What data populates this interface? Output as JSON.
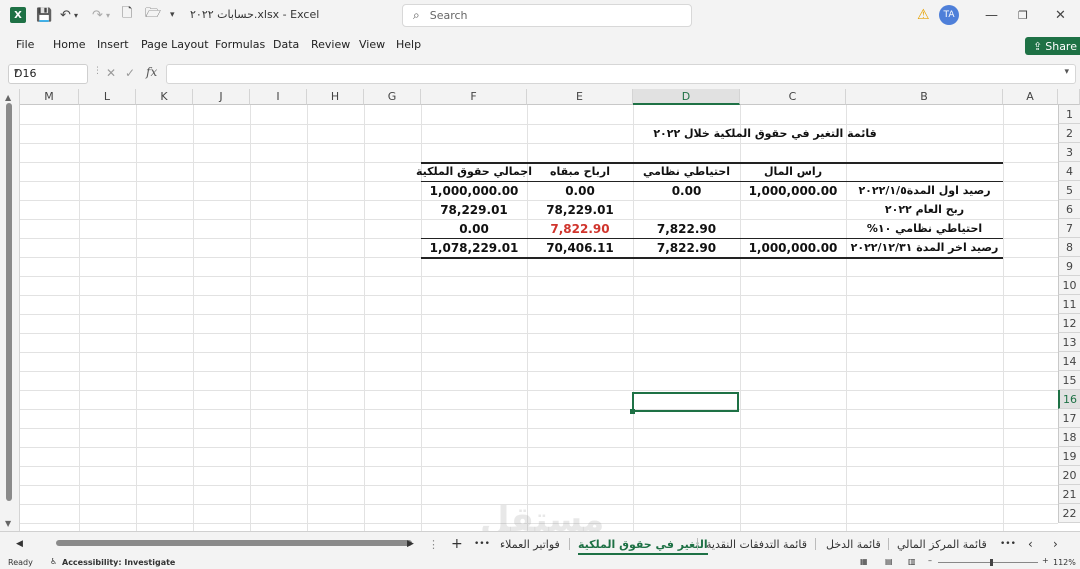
{
  "app": {
    "logo": "X",
    "file_title": "حسابات ٢٠٢٢.xlsx  -  Excel",
    "search_placeholder": "Search",
    "user_initials": "TA",
    "share_label": "Share"
  },
  "menu": [
    "File",
    "Home",
    "Insert",
    "Page Layout",
    "Formulas",
    "Data",
    "Review",
    "View",
    "Help"
  ],
  "formula_bar": {
    "cell_ref": "D16",
    "fx": "fx",
    "content": ""
  },
  "columns": [
    "M",
    "L",
    "K",
    "J",
    "I",
    "H",
    "G",
    "F",
    "E",
    "D",
    "C",
    "B",
    "A"
  ],
  "rows": [
    "1",
    "2",
    "3",
    "4",
    "5",
    "6",
    "7",
    "8",
    "9",
    "10",
    "11",
    "12",
    "13",
    "14",
    "15",
    "16",
    "17",
    "18",
    "19",
    "20",
    "21",
    "22"
  ],
  "selected": {
    "column": "D",
    "row": "16"
  },
  "sheet": {
    "title": "قائمة التغير في حقوق الملكية خلال ٢٠٢٢",
    "headers": {
      "capital": "راس المال",
      "legal_reserve": "احتياطي نظامي",
      "retained_earnings": "ارباح مبقاه",
      "total_equity": "اجمالي حقوق الملكية"
    },
    "rows": [
      {
        "label": "رصيد اول المدة٢٠٢٢/١/٥",
        "capital": "1,000,000.00",
        "legal_reserve": "0.00",
        "retained_earnings": "0.00",
        "total": "1,000,000.00"
      },
      {
        "label": "ربح العام ٢٠٢٢",
        "capital": "",
        "legal_reserve": "",
        "retained_earnings": "78,229.01",
        "total": "78,229.01"
      },
      {
        "label": "احتياطي نظامي ١٠%",
        "capital": "",
        "legal_reserve": "7,822.90",
        "retained_earnings": "7,822.90",
        "total": "0.00"
      },
      {
        "label": "رصيد اخر المدة ٢٠٢٢/١٢/٣١",
        "capital": "1,000,000.00",
        "legal_reserve": "7,822.90",
        "retained_earnings": "70,406.11",
        "total": "1,078,229.01"
      }
    ],
    "highlight_color": "#d0342c"
  },
  "tabs": {
    "items": [
      "قائمة المركز المالي",
      "قائمة الدخل",
      "قائمة التدفقات النقدية",
      "التغير في حقوق الملكية",
      "فواتير العملاء"
    ],
    "active": "التغير في حقوق الملكية",
    "more": "•••",
    "add": "+"
  },
  "status": {
    "ready": "Ready",
    "accessibility": "Accessibility: Investigate",
    "zoom": "112%"
  },
  "watermark": "مستقل",
  "colors": {
    "excel_green": "#1e7145",
    "accent_blue": "#4e7fd9"
  }
}
